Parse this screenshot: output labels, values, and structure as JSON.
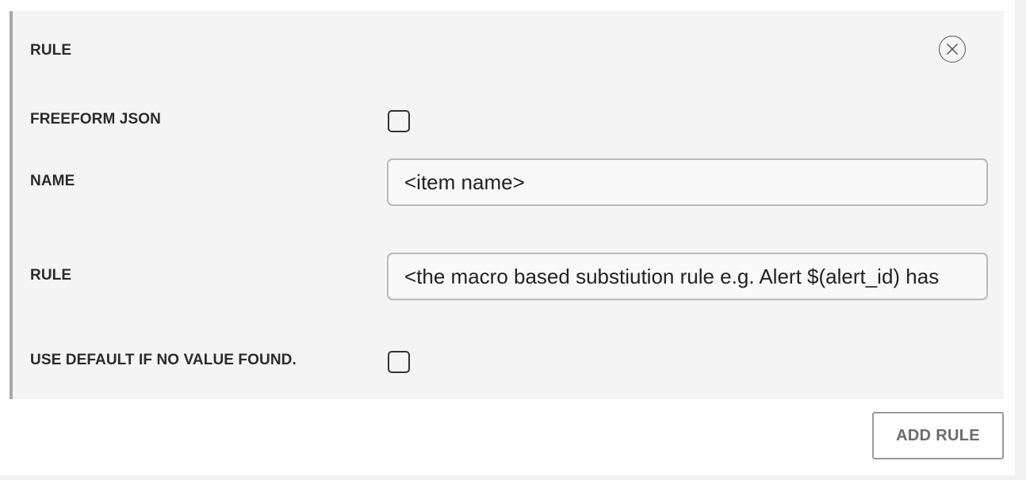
{
  "rule_panel": {
    "title": "RULE",
    "close_icon": "close-circle-icon",
    "freeform_json": {
      "label": "FREEFORM JSON",
      "checked": false
    },
    "name": {
      "label": "NAME",
      "value": "<item name>"
    },
    "rule": {
      "label": "RULE",
      "value": "<the macro based substiution rule e.g. Alert $(alert_id) has"
    },
    "use_default": {
      "label": "USE DEFAULT IF NO VALUE FOUND.",
      "checked": false
    }
  },
  "actions": {
    "add_rule_label": "ADD RULE"
  },
  "colors": {
    "panel_background": "#f4f4f4",
    "panel_border": "#a8a8a8",
    "input_border": "#b9b9b9",
    "button_text": "#6b6b6b"
  }
}
